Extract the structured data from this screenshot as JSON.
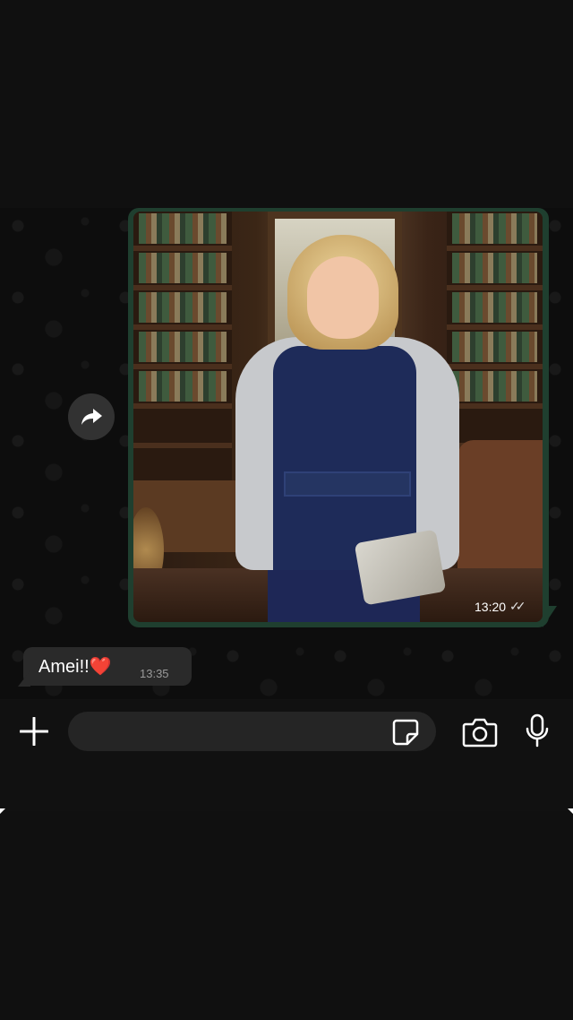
{
  "conversation": {
    "outgoing_photo": {
      "time": "13:20",
      "status": "read",
      "status_icon": "double-check-icon"
    },
    "incoming_message": {
      "text": "Amei!!❤️",
      "time": "13:35"
    },
    "forward_button": {
      "icon": "forward-arrow-icon"
    }
  },
  "composer": {
    "add_icon": "plus-icon",
    "input_value": "",
    "sticker_icon": "sticker-icon",
    "camera_icon": "camera-icon",
    "mic_icon": "microphone-icon"
  },
  "colors": {
    "outgoing_bubble": "#1f3f2f",
    "incoming_bubble": "#2a2a2a",
    "background": "#101010"
  }
}
